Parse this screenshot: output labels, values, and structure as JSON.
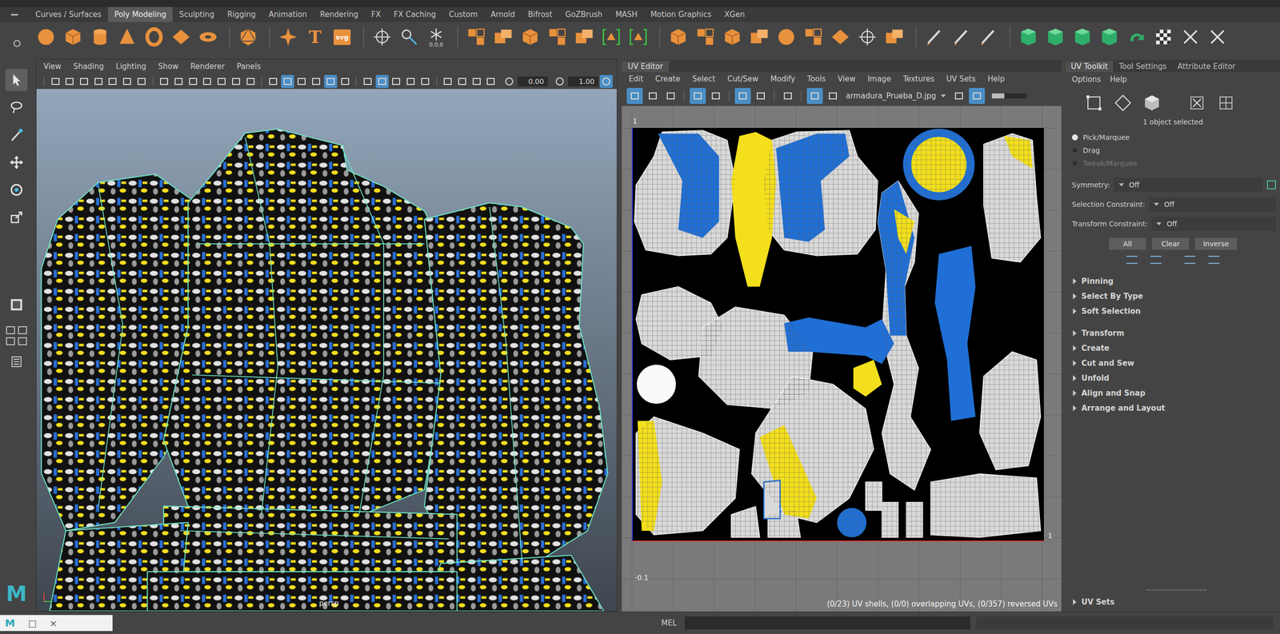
{
  "app": {
    "logo": "M"
  },
  "shelf": {
    "tabs": [
      {
        "label": "Curves / Surfaces",
        "selected": false
      },
      {
        "label": "Poly Modeling",
        "selected": true
      },
      {
        "label": "Sculpting",
        "selected": false
      },
      {
        "label": "Rigging",
        "selected": false
      },
      {
        "label": "Animation",
        "selected": false
      },
      {
        "label": "Rendering",
        "selected": false
      },
      {
        "label": "FX",
        "selected": false
      },
      {
        "label": "FX Caching",
        "selected": false
      },
      {
        "label": "Custom",
        "selected": false
      },
      {
        "label": "Arnold",
        "selected": false
      },
      {
        "label": "Bifrost",
        "selected": false
      },
      {
        "label": "GoZBrush",
        "selected": false
      },
      {
        "label": "MASH",
        "selected": false
      },
      {
        "label": "Motion Graphics",
        "selected": false
      },
      {
        "label": "XGen",
        "selected": false
      }
    ],
    "icon_texts": {
      "type": "T",
      "svg": "svg",
      "origin": "0,0,0"
    }
  },
  "toolbox": {
    "tools": [
      {
        "kind": "select",
        "selected": true
      },
      {
        "kind": "lasso",
        "selected": false
      },
      {
        "kind": "paint",
        "selected": false
      },
      {
        "kind": "move",
        "selected": false
      },
      {
        "kind": "rotate",
        "selected": false
      },
      {
        "kind": "scale",
        "selected": false
      }
    ]
  },
  "viewport": {
    "menu": [
      "View",
      "Shading",
      "Lighting",
      "Show",
      "Renderer",
      "Panels"
    ],
    "toolbar": [
      [
        false,
        false,
        false,
        false,
        false,
        false,
        false
      ],
      [
        false,
        false,
        false,
        false,
        false,
        false,
        false
      ],
      [
        false,
        true,
        false,
        false,
        true,
        false
      ],
      [
        false,
        true,
        false,
        false,
        false
      ],
      [
        false,
        false,
        false,
        false
      ]
    ],
    "fields": [
      "0.00",
      "1.00"
    ],
    "trailing_on": true,
    "camera": "persp"
  },
  "uv_editor": {
    "title": "UV Editor",
    "menu": [
      "Edit",
      "Create",
      "Select",
      "Cut/Sew",
      "Modify",
      "Tools",
      "View",
      "Image",
      "Textures",
      "UV Sets",
      "Help"
    ],
    "toolbar": [
      [
        true,
        false,
        false
      ],
      [
        true,
        false
      ],
      [
        true,
        false
      ],
      [
        false
      ],
      [
        true,
        false
      ]
    ],
    "texture": "armadura_Prueba_D.jpg",
    "after_texture": [
      false,
      true
    ],
    "slider_level": 0.35,
    "labels": {
      "top": "1",
      "right": "1",
      "bottom": "-0.1"
    },
    "status": "(0/23) UV shells, (0/0) overlapping UVs, (0/357) reversed UVs"
  },
  "toolkit": {
    "tabs": [
      {
        "label": "UV Toolkit",
        "selected": true
      },
      {
        "label": "Tool Settings",
        "selected": false
      },
      {
        "label": "Attribute Editor",
        "selected": false
      }
    ],
    "menu": [
      "Options",
      "Help"
    ],
    "selection_info": "1 object selected",
    "modes": [
      {
        "label": "Pick/Marquee",
        "selected": true,
        "disabled": false
      },
      {
        "label": "Drag",
        "selected": false,
        "disabled": false
      },
      {
        "label": "Tweak/Marquee",
        "selected": false,
        "disabled": true
      }
    ],
    "settings": [
      {
        "label": "Symmetry:",
        "value": "Off"
      },
      {
        "label": "Selection Constraint:",
        "value": "Off"
      },
      {
        "label": "Transform Constraint:",
        "value": "Off"
      }
    ],
    "buttons": [
      "All",
      "Clear",
      "Inverse"
    ],
    "section_groups": [
      [
        {
          "label": "Pinning",
          "expanded": false
        },
        {
          "label": "Select By Type",
          "expanded": false
        },
        {
          "label": "Soft Selection",
          "expanded": false
        }
      ],
      [
        {
          "label": "Transform",
          "expanded": false
        },
        {
          "label": "Create",
          "expanded": false
        },
        {
          "label": "Cut and Sew",
          "expanded": false
        },
        {
          "label": "Unfold",
          "expanded": false
        },
        {
          "label": "Align and Snap",
          "expanded": false
        },
        {
          "label": "Arrange and Layout",
          "expanded": false
        }
      ]
    ],
    "footer_section": {
      "label": "UV Sets",
      "expanded": false
    }
  },
  "command_line": {
    "mode": "MEL"
  },
  "minimized_window": {
    "logo": "M",
    "controls": [
      "□",
      "×"
    ]
  }
}
